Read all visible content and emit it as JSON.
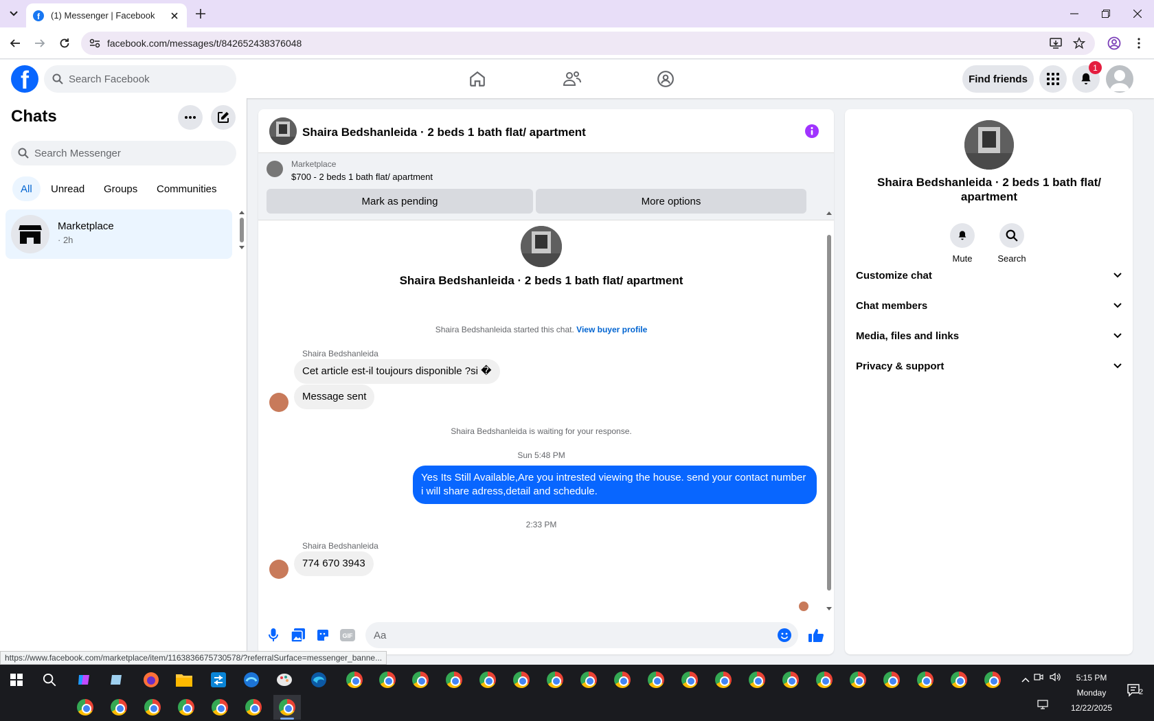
{
  "browser": {
    "tab_title": "(1) Messenger | Facebook",
    "url": "facebook.com/messages/t/842652438376048",
    "status_url": "https://www.facebook.com/marketplace/item/1163836675730578/?referralSurface=messenger_banne..."
  },
  "fb_header": {
    "search_placeholder": "Search Facebook",
    "find_friends": "Find friends",
    "notification_count": "1"
  },
  "sidebar": {
    "title": "Chats",
    "search_placeholder": "Search Messenger",
    "filters": [
      "All",
      "Unread",
      "Groups",
      "Communities"
    ],
    "chats": [
      {
        "name": "Marketplace",
        "time": "· 2h"
      }
    ]
  },
  "conversation": {
    "title": "Shaira Bedshanleida · 2 beds 1 bath flat/ apartment",
    "banner": {
      "label": "Marketplace",
      "item": "$700 - 2 beds 1 bath flat/ apartment",
      "btn_pending": "Mark as pending",
      "btn_more": "More options"
    },
    "intro_title": "Shaira Bedshanleida · 2 beds 1 bath flat/ apartment",
    "started_text": "Shaira Bedshanleida started this chat.",
    "view_profile": "View buyer profile",
    "sender_name": "Shaira Bedshanleida",
    "msg1": "Cet article est-il toujours disponible ?si �",
    "msg2": "Message sent",
    "waiting_text": "Shaira Bedshanleida is waiting for your response.",
    "time1": "Sun 5:48 PM",
    "out_msg": "Yes Its Still Available,Are you intrested viewing the house. send your contact number i will share adress,detail and schedule.",
    "time2": "2:33 PM",
    "sender_name2": "Shaira Bedshanleida",
    "msg3": "774 670 3943",
    "composer_placeholder": "Aa"
  },
  "details": {
    "title": "Shaira Bedshanleida · 2 beds 1 bath flat/ apartment",
    "mute": "Mute",
    "search": "Search",
    "rows": [
      "Customize chat",
      "Chat members",
      "Media, files and links",
      "Privacy & support"
    ]
  },
  "taskbar": {
    "time": "5:15 PM",
    "day": "Monday",
    "date": "12/22/2025",
    "notif_count": "2"
  },
  "colors": {
    "accent": "#0866ff",
    "info": "#a033ff",
    "badge": "#e41e3f",
    "tabbar": "#e8def8"
  }
}
